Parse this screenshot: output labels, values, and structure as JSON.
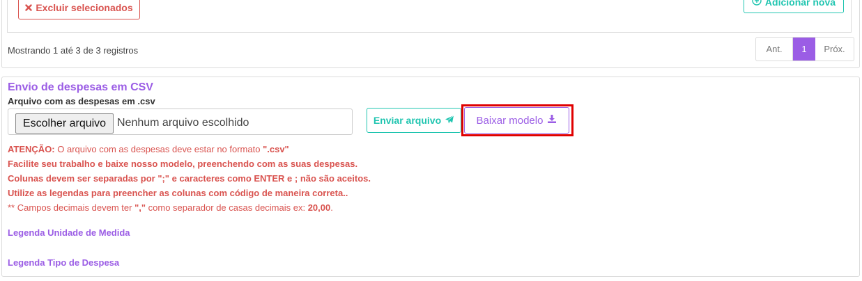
{
  "table_section": {
    "delete_selected_label": "Excluir selecionados",
    "add_new_label": "Adicionar nova",
    "records_info": "Mostrando 1 até 3 de 3 registros",
    "pagination": {
      "prev_label": "Ant.",
      "current_page": "1",
      "next_label": "Próx."
    }
  },
  "csv_section": {
    "title": "Envio de despesas em CSV",
    "file_label": "Arquivo com as despesas em .csv",
    "choose_file_label": "Escolher arquivo",
    "no_file_text": "Nenhum arquivo escolhido",
    "send_button_label": "Enviar arquivo",
    "download_model_label": "Baixar modelo",
    "warnings": {
      "attention_prefix": "ATENÇÃO:",
      "attention_text": " O arquivo com as despesas deve estar no formato ",
      "attention_format": "\".csv\"",
      "line2": "Facilite seu trabalho e baixe nosso modelo, preenchendo com as suas despesas.",
      "line3": "Colunas devem ser separadas por \";\" e caracteres como ENTER e ; não são aceitos.",
      "line4": "Utilize as legendas para preencher as colunas com código de maneira correta..",
      "line5_prefix": "** Campos decimais devem ter ",
      "line5_sep": "\",\"",
      "line5_mid": " como separador de casas decimais ex: ",
      "line5_example": "20,00",
      "line5_end": "."
    },
    "legend_unit_label": "Legenda Unidade de Medida",
    "legend_expense_type_label": "Legenda Tipo de Despesa"
  },
  "colors": {
    "accent_purple": "#9b5de5",
    "teal": "#20c5b0",
    "danger": "#d9534f",
    "highlight_red": "#e00000"
  },
  "icons": {
    "delete": "times-icon",
    "add": "plus-circle-icon",
    "send": "paper-plane-icon",
    "download": "download-icon"
  }
}
